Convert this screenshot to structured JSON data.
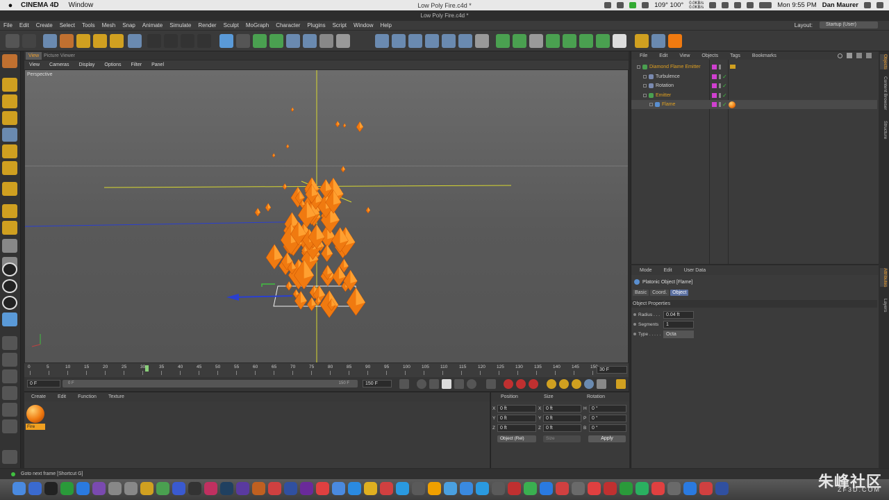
{
  "macbar": {
    "app_name": "CINEMA 4D",
    "window_menu": "Window",
    "document_title": "Low Poly Fire.c4d *",
    "temps": "109° 100°",
    "net_up": "0.0KB/s",
    "net_down": "0.0KB/s",
    "clock": "Mon 9:55 PM",
    "user": "Dan Maurer"
  },
  "app_menu": [
    "File",
    "Edit",
    "Create",
    "Select",
    "Tools",
    "Mesh",
    "Snap",
    "Animate",
    "Simulate",
    "Render",
    "Sculpt",
    "MoGraph",
    "Character",
    "Plugins",
    "Script",
    "Window",
    "Help"
  ],
  "layout": {
    "label": "Layout:",
    "value": "Startup (User)"
  },
  "viewport": {
    "tabs": [
      "View",
      "Picture Viewer"
    ],
    "menu": [
      "View",
      "Cameras",
      "Display",
      "Options",
      "Filter",
      "Panel"
    ],
    "camera": "Perspective"
  },
  "timeline": {
    "ticks": [
      "0",
      "5",
      "10",
      "15",
      "20",
      "25",
      "30",
      "35",
      "40",
      "45",
      "50",
      "55",
      "60",
      "65",
      "70",
      "75",
      "80",
      "85",
      "90",
      "95",
      "100",
      "105",
      "110",
      "115",
      "120",
      "125",
      "130",
      "135",
      "140",
      "145",
      "150"
    ],
    "current_frame_fraction": 0.207,
    "end_display": "30 F",
    "start_field": "0 F",
    "range_start": "0 F",
    "range_end": "150 F",
    "end_field": "150 F"
  },
  "material_manager": {
    "menu": [
      "Create",
      "Edit",
      "Function",
      "Texture"
    ],
    "materials": [
      {
        "name": "Fire",
        "color": "#f07a10"
      }
    ]
  },
  "coordinates": {
    "headers": [
      "Position",
      "Size",
      "Rotation"
    ],
    "rows": [
      {
        "axis": "X",
        "pos": "0 ft",
        "saxis": "X",
        "size": "0 ft",
        "raxis": "H",
        "rot": "0 °"
      },
      {
        "axis": "Y",
        "pos": "0 ft",
        "saxis": "Y",
        "size": "0 ft",
        "raxis": "P",
        "rot": "0 °"
      },
      {
        "axis": "Z",
        "pos": "0 ft",
        "saxis": "Z",
        "size": "0 ft",
        "raxis": "B",
        "rot": "0 °"
      }
    ],
    "mode_select": "Object (Rel)",
    "size_select": "Size",
    "apply_label": "Apply"
  },
  "object_manager": {
    "menu": [
      "File",
      "Edit",
      "View",
      "Objects",
      "Tags",
      "Bookmarks"
    ],
    "objects": [
      {
        "name": "Diamond Flame Emitter",
        "indent": 0,
        "color": "#e0a020"
      },
      {
        "name": "Turbulence",
        "indent": 1,
        "color": "#d0d0d0"
      },
      {
        "name": "Rotation",
        "indent": 1,
        "color": "#d0d0d0"
      },
      {
        "name": "Emitter",
        "indent": 1,
        "color": "#e0a020"
      },
      {
        "name": "Flame",
        "indent": 2,
        "color": "#e0a020"
      }
    ]
  },
  "attributes": {
    "menu": [
      "Mode",
      "Edit",
      "User Data"
    ],
    "object_title": "Platonic Object [Flame]",
    "tabs": [
      "Basic",
      "Coord.",
      "Object"
    ],
    "active_tab": "Object",
    "section": "Object Properties",
    "props": [
      {
        "label": "Radius . . .",
        "value": "0.04 ft"
      },
      {
        "label": "Segments",
        "value": "1"
      },
      {
        "label": "Type . . . . .",
        "value": "Octa"
      }
    ]
  },
  "side_tabs": [
    "Objects",
    "Content Browser",
    "Structure"
  ],
  "side_tabs_lower": [
    "Attributes",
    "Layers"
  ],
  "status_text": "Goto next frame [Shortcut G]",
  "watermark": {
    "title": "朱峰社区",
    "sub": "ZF3D.COM"
  },
  "colors": {
    "accent_orange": "#f07a10",
    "axis_yellow": "#d8d830",
    "axis_blue": "#2a3fd0",
    "axis_green": "#40c040"
  }
}
